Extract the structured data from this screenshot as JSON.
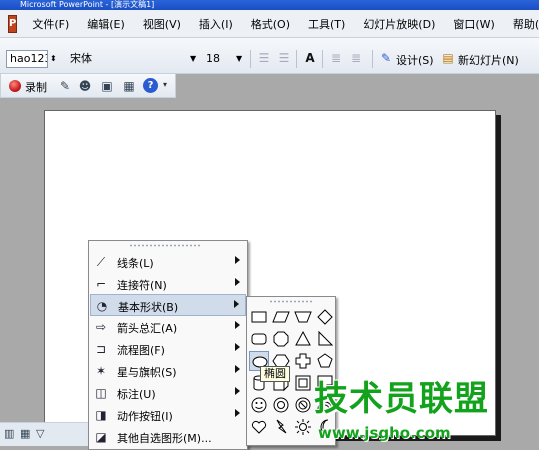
{
  "window": {
    "title": "Microsoft PowerPoint - [演示文稿1]"
  },
  "menubar": {
    "items": [
      "文件(F)",
      "编辑(E)",
      "视图(V)",
      "插入(I)",
      "格式(O)",
      "工具(T)",
      "幻灯片放映(D)",
      "窗口(W)",
      "帮助(H)"
    ]
  },
  "toolbar_format": {
    "style_box": "hao123",
    "font_name": "宋体",
    "font_size": "18",
    "design_label": "设计(S)",
    "new_slide_label": "新幻灯片(N)"
  },
  "toolbar_two": {
    "record_label": "录制"
  },
  "autoshapes_menu": {
    "items": [
      {
        "label": "线条(L)",
        "icon": "lines-icon",
        "has_submenu": true
      },
      {
        "label": "连接符(N)",
        "icon": "connector-icon",
        "has_submenu": true
      },
      {
        "label": "基本形状(B)",
        "icon": "basic-shapes-icon",
        "has_submenu": true,
        "highlighted": true
      },
      {
        "label": "箭头总汇(A)",
        "icon": "block-arrows-icon",
        "has_submenu": true
      },
      {
        "label": "流程图(F)",
        "icon": "flowchart-icon",
        "has_submenu": true
      },
      {
        "label": "星与旗帜(S)",
        "icon": "stars-banners-icon",
        "has_submenu": true
      },
      {
        "label": "标注(U)",
        "icon": "callouts-icon",
        "has_submenu": true
      },
      {
        "label": "动作按钮(I)",
        "icon": "action-buttons-icon",
        "has_submenu": true
      },
      {
        "label": "其他自选图形(M)...",
        "icon": "more-autoshapes-icon",
        "has_submenu": false
      }
    ]
  },
  "basic_shapes": {
    "tooltip": "椭圆",
    "selected": "oval"
  },
  "watermark": {
    "title": "技术员联盟",
    "url": "www.jsgho.com"
  }
}
